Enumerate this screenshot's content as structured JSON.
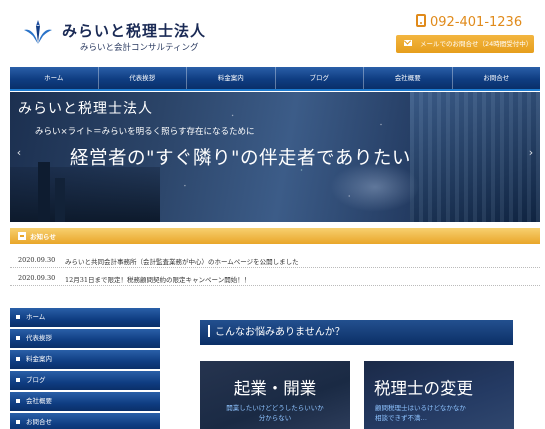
{
  "header": {
    "title": "みらいと税理士法人",
    "subtitle": "みらいと会計コンサルティング",
    "phone": "092-401-1236",
    "mail_label": "メールでのお問合せ（24時間受付中）"
  },
  "nav": [
    "ホーム",
    "代表挨拶",
    "料金案内",
    "ブログ",
    "会社概要",
    "お問合せ"
  ],
  "hero": {
    "title": "みらいと税理士法人",
    "subtitle": "みらい×ライト＝みらいを明るく照らす存在になるために",
    "main": "経営者の\"すぐ隣り\"の伴走者でありたい",
    "prev": "‹",
    "next": "›"
  },
  "news": {
    "heading": "お知らせ",
    "items": [
      {
        "date": "2020.09.30",
        "text": "みらいと共同会計事務所（会計監査業務が中心）のホームページを公開しました"
      },
      {
        "date": "2020.09.30",
        "text": "12月31日まで限定！税務顧問契約の限定キャンペーン開始！！"
      }
    ]
  },
  "sidebar": [
    "ホーム",
    "代表挨拶",
    "料金案内",
    "ブログ",
    "会社概要",
    "お問合せ"
  ],
  "content": {
    "worry_heading": "こんなお悩みありませんか？",
    "cards": [
      {
        "title": "起業・開業",
        "desc_1": "開業したいけどどうしたらいいか",
        "desc_2": "分からない"
      },
      {
        "title": "税理士の変更",
        "desc_1": "顧問税理士はいるけどなかなか",
        "desc_2": "相談できず不満…"
      }
    ]
  },
  "colors": {
    "navy": "#0f3d82",
    "orange": "#e69e1c",
    "phone": "#e08a1a"
  }
}
